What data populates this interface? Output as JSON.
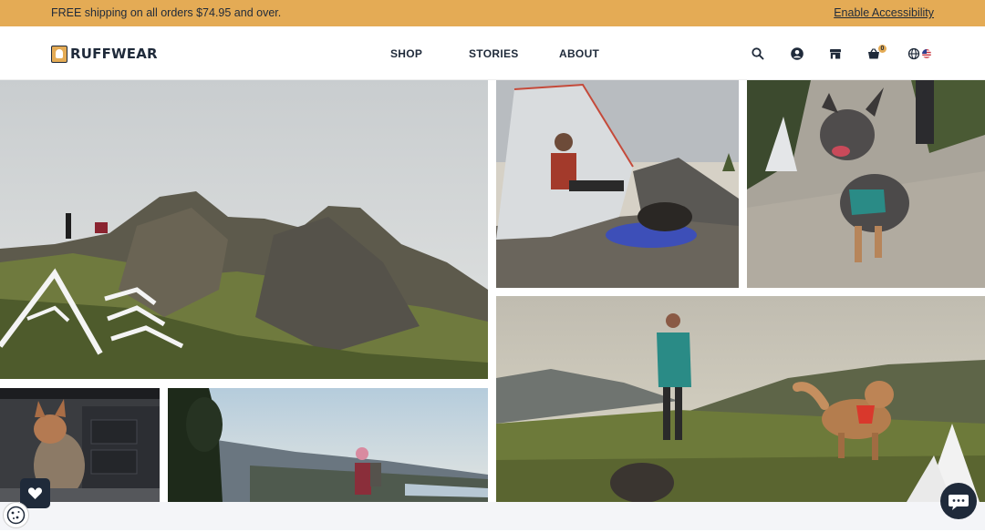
{
  "promo": {
    "text": "FREE shipping on all orders $74.95 and over.",
    "accessibility_link": "Enable Accessibility"
  },
  "brand": {
    "name": "RUFFWEAR"
  },
  "nav": {
    "items": [
      {
        "label": "SHOP"
      },
      {
        "label": "STORIES"
      },
      {
        "label": "ABOUT"
      }
    ],
    "icons": [
      "search-icon",
      "account-icon",
      "store-icon",
      "cart-icon",
      "globe-icon",
      "us-flag-icon"
    ],
    "cart_count": "0"
  },
  "colors": {
    "promo_bg": "#e4ab55",
    "brand_navy": "#1f2a3a",
    "tent_pad": "#3d4fb8",
    "harness_teal": "#2a8b86",
    "harness_red": "#d9382c"
  },
  "gallery": {
    "photos": [
      "mountain-ridge-hikers",
      "tent-camper-with-dog",
      "cattle-dog-on-trail",
      "dog-in-kitchen",
      "hiker-at-lakeside-sunset",
      "hiker-with-two-dogs-meadow"
    ]
  },
  "floating": {
    "favorites_icon": "heart-icon",
    "cookie_icon": "cookie-icon",
    "chat_icon": "chat-icon"
  }
}
